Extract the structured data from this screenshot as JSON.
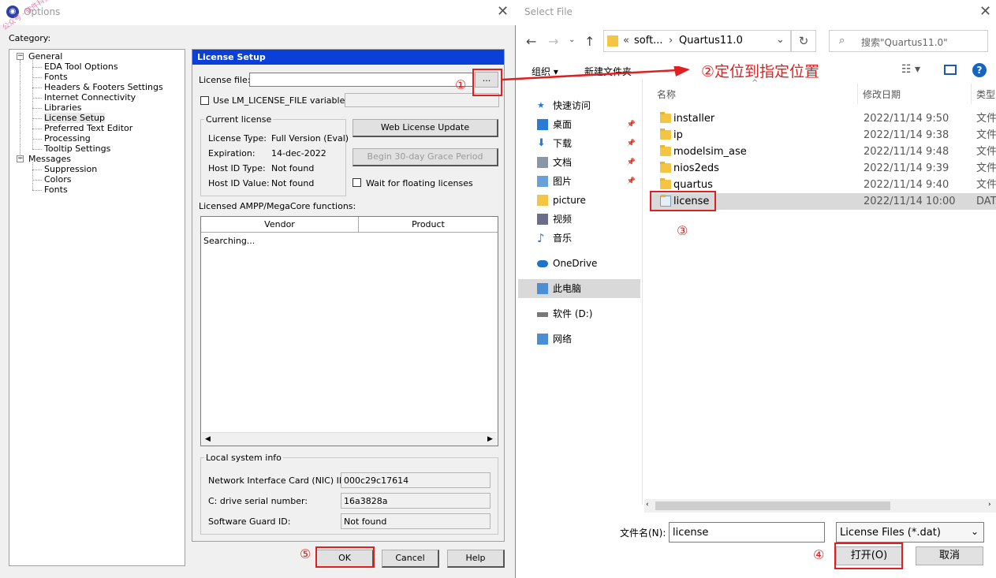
{
  "options": {
    "title": "Options",
    "watermark": "公众号 · 软件科技",
    "category_label": "Category:",
    "tree": [
      {
        "label": "General",
        "level": 0,
        "toggle": "−"
      },
      {
        "label": "EDA Tool Options",
        "level": 1
      },
      {
        "label": "Fonts",
        "level": 1
      },
      {
        "label": "Headers & Footers Settings",
        "level": 1
      },
      {
        "label": "Internet Connectivity",
        "level": 1
      },
      {
        "label": "Libraries",
        "level": 1
      },
      {
        "label": "License Setup",
        "level": 1
      },
      {
        "label": "Preferred Text Editor",
        "level": 1
      },
      {
        "label": "Processing",
        "level": 1
      },
      {
        "label": "Tooltip Settings",
        "level": 1
      },
      {
        "label": "Messages",
        "level": 0,
        "toggle": "−"
      },
      {
        "label": "Suppression",
        "level": 1
      },
      {
        "label": "Colors",
        "level": 1
      },
      {
        "label": "Fonts",
        "level": 1
      }
    ],
    "panel_title": "License Setup",
    "license_file_label": "License file:",
    "license_file_value": "",
    "browse_label": "...",
    "use_env_label": "Use LM_LICENSE_FILE variable:",
    "current_license_label": "Current license",
    "license_type_label": "License Type:",
    "license_type_value": "Full Version (Eval)",
    "expiration_label": "Expiration:",
    "expiration_value": "14-dec-2022",
    "host_id_type_label": "Host ID Type:",
    "host_id_type_value": "Not found",
    "host_id_value_label": "Host ID Value:",
    "host_id_value_value": "Not found",
    "web_update_label": "Web License Update",
    "grace_label": "Begin 30-day Grace Period",
    "wait_floating_label": "Wait for floating licenses",
    "ampp_label": "Licensed AMPP/MegaCore functions:",
    "col_vendor": "Vendor",
    "col_product": "Product",
    "searching": "Searching...",
    "local_info_label": "Local system info",
    "nic_label": "Network Interface Card (NIC) ID:",
    "nic_value": "000c29c17614",
    "serial_label": "C: drive serial number:",
    "serial_value": "16a3828a",
    "guard_label": "Software Guard ID:",
    "guard_value": "Not found",
    "ok_label": "OK",
    "cancel_label": "Cancel",
    "help_label": "Help"
  },
  "annotations": {
    "n1": "①",
    "n2": "②定位到指定位置",
    "n3": "③",
    "n4": "④",
    "n5": "⑤",
    "color": "#e02020"
  },
  "selectfile": {
    "title": "Select File",
    "path_prefix": "«",
    "path1": "soft...",
    "path_sep": "›",
    "path2": "Quartus11.0",
    "search_placeholder": "搜索\"Quartus11.0\"",
    "organize": "组织 ▾",
    "new_folder": "新建文件夹",
    "nav": [
      {
        "label": "快速访问",
        "icon": "star-icon",
        "pin": false
      },
      {
        "label": "桌面",
        "icon": "desktop-icon",
        "pin": true
      },
      {
        "label": "下载",
        "icon": "download-icon",
        "pin": true
      },
      {
        "label": "文档",
        "icon": "document-icon",
        "pin": true
      },
      {
        "label": "图片",
        "icon": "picture-icon",
        "pin": true
      },
      {
        "label": "picture",
        "icon": "folder-icon",
        "pin": false
      },
      {
        "label": "视频",
        "icon": "video-icon",
        "pin": false
      },
      {
        "label": "音乐",
        "icon": "music-icon",
        "pin": false
      },
      {
        "label": "OneDrive",
        "icon": "cloud-icon",
        "pin": false
      },
      {
        "label": "此电脑",
        "icon": "computer-icon",
        "pin": false
      },
      {
        "label": "软件 (D:)",
        "icon": "drive-icon",
        "pin": false
      },
      {
        "label": "网络",
        "icon": "network-icon",
        "pin": false
      }
    ],
    "col_name": "名称",
    "col_date": "修改日期",
    "col_type": "类型",
    "files": [
      {
        "name": "installer",
        "date": "2022/11/14 9:50",
        "type": "文件",
        "kind": "folder"
      },
      {
        "name": "ip",
        "date": "2022/11/14 9:38",
        "type": "文件",
        "kind": "folder"
      },
      {
        "name": "modelsim_ase",
        "date": "2022/11/14 9:48",
        "type": "文件",
        "kind": "folder"
      },
      {
        "name": "nios2eds",
        "date": "2022/11/14 9:39",
        "type": "文件",
        "kind": "folder"
      },
      {
        "name": "quartus",
        "date": "2022/11/14 9:40",
        "type": "文件",
        "kind": "folder"
      },
      {
        "name": "license",
        "date": "2022/11/14 10:00",
        "type": "DAT",
        "kind": "file"
      }
    ],
    "filename_label": "文件名(N):",
    "filename_value": "license",
    "filetype_value": "License Files (*.dat)",
    "open_label": "打开(O)",
    "cancel_label": "取消"
  }
}
